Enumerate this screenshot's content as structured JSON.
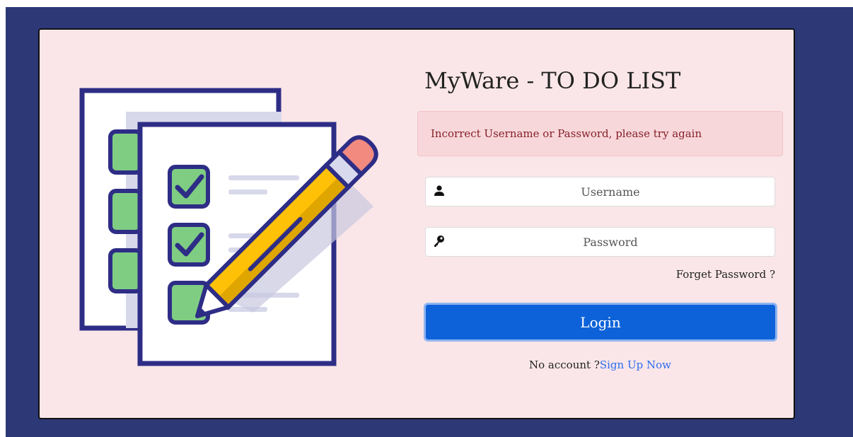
{
  "app": {
    "title": "MyWare - TO DO LIST"
  },
  "alert": {
    "message": "Incorrect Username or Password, please try again"
  },
  "form": {
    "username": {
      "placeholder": "Username",
      "value": "",
      "icon": "user-icon"
    },
    "password": {
      "placeholder": "Password",
      "value": "",
      "icon": "key-icon"
    },
    "forget_label": "Forget Password ?",
    "login_label": "Login"
  },
  "signup": {
    "prompt": "No account ?",
    "link_label": "Sign Up Now"
  },
  "colors": {
    "backdrop": "#2d3877",
    "card": "#fae6e8",
    "alert_bg": "#f8d7da",
    "alert_text": "#842029",
    "primary": "#0d62d9",
    "link": "#2d6cf0"
  },
  "illustration": {
    "name": "checklist-with-pencil-illustration"
  }
}
